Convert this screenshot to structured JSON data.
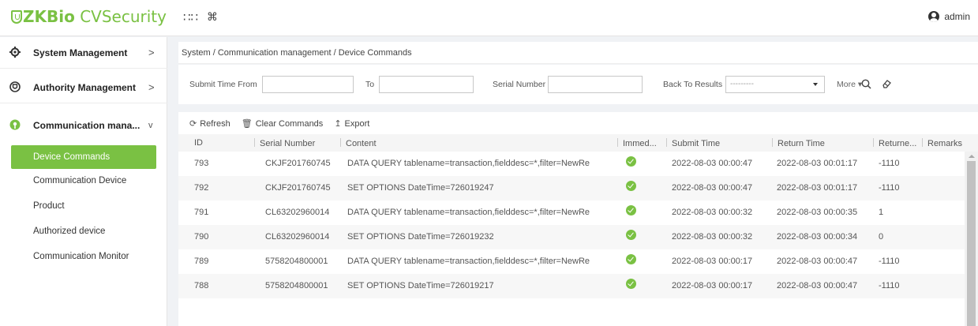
{
  "header": {
    "logo_brand": "ZKBio",
    "logo_product": " CVSecurity",
    "apps_icon": "grid-icon",
    "shortcut_icon": "command-icon",
    "user_name": "admin"
  },
  "sidebar": {
    "groups": [
      {
        "label": "System Management",
        "icon": "gear-icon",
        "chevron": ">"
      },
      {
        "label": "Authority Management",
        "icon": "shield-icon",
        "chevron": ">"
      },
      {
        "label": "Communication mana...",
        "icon": "communication-icon",
        "chevron": "v"
      }
    ],
    "items": [
      {
        "label": "Device Commands",
        "active": true
      },
      {
        "label": "Communication Device"
      },
      {
        "label": "Product"
      },
      {
        "label": "Authorized device"
      },
      {
        "label": "Communication Monitor"
      }
    ]
  },
  "breadcrumb": "System / Communication management / Device Commands",
  "filter": {
    "submit_time_from_label": "Submit Time From",
    "to_label": "To",
    "serial_number_label": "Serial Number",
    "back_to_results_label": "Back To Results",
    "back_to_results_value": "---------",
    "more_label": "More",
    "submit_time_from_value": "",
    "to_value": "",
    "serial_number_value": ""
  },
  "toolbar": {
    "refresh": "Refresh",
    "clear_commands": "Clear Commands",
    "export": "Export"
  },
  "table": {
    "columns": [
      "ID",
      "Serial Number",
      "Content",
      "Immed...",
      "Submit Time",
      "Return Time",
      "Returne...",
      "Remarks"
    ],
    "rows": [
      {
        "id": "793",
        "serial": "CKJF201760745",
        "content": "DATA QUERY tablename=transaction,fielddesc=*,filter=NewRe",
        "immediate": true,
        "submit": "2022-08-03 00:00:47",
        "return": "2022-08-03 00:01:17",
        "returned": "-1110",
        "remarks": ""
      },
      {
        "id": "792",
        "serial": "CKJF201760745",
        "content": "SET OPTIONS DateTime=726019247",
        "immediate": true,
        "submit": "2022-08-03 00:00:47",
        "return": "2022-08-03 00:01:17",
        "returned": "-1110",
        "remarks": ""
      },
      {
        "id": "791",
        "serial": "CL63202960014",
        "content": "DATA QUERY tablename=transaction,fielddesc=*,filter=NewRe",
        "immediate": true,
        "submit": "2022-08-03 00:00:32",
        "return": "2022-08-03 00:00:35",
        "returned": "1",
        "remarks": ""
      },
      {
        "id": "790",
        "serial": "CL63202960014",
        "content": "SET OPTIONS DateTime=726019232",
        "immediate": true,
        "submit": "2022-08-03 00:00:32",
        "return": "2022-08-03 00:00:34",
        "returned": "0",
        "remarks": ""
      },
      {
        "id": "789",
        "serial": "5758204800001",
        "content": "DATA QUERY tablename=transaction,fielddesc=*,filter=NewRe",
        "immediate": true,
        "submit": "2022-08-03 00:00:17",
        "return": "2022-08-03 00:00:47",
        "returned": "-1110",
        "remarks": ""
      },
      {
        "id": "788",
        "serial": "5758204800001",
        "content": "SET OPTIONS DateTime=726019217",
        "immediate": true,
        "submit": "2022-08-03 00:00:17",
        "return": "2022-08-03 00:00:47",
        "returned": "-1110",
        "remarks": ""
      }
    ]
  },
  "colors": {
    "accent": "#7ac143",
    "row_alt": "#f7f7f7"
  }
}
